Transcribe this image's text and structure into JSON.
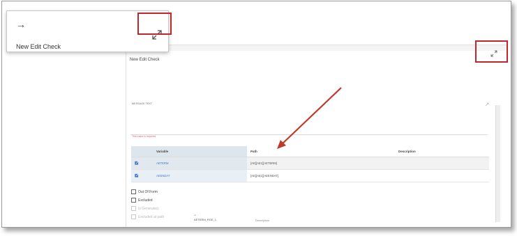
{
  "zoom_card": {
    "back_arrow": "→",
    "title": "New Edit Check"
  },
  "dialog": {
    "title": "New Edit Check",
    "message_label": "MESSAGE TEXT",
    "error_text": "This value is required"
  },
  "table": {
    "headers": [
      "",
      "Variable",
      "Path",
      "Description"
    ],
    "rows": [
      {
        "variable": "AETERM",
        "path": "[AE][AE1][AETERM]",
        "description": ""
      },
      {
        "variable": "AEENDAT",
        "path": "[AE][AE1][AEENDAT]",
        "description": ""
      }
    ]
  },
  "checkboxes": [
    {
      "label": "Out Of Form",
      "disabled": false
    },
    {
      "label": "Excluded",
      "disabled": false
    },
    {
      "label": "Is Generated",
      "disabled": true
    },
    {
      "label": "Excluded at path",
      "disabled": true
    }
  ],
  "footer": {
    "id_label": "Id",
    "id_value": "AETERM_RGE_1",
    "description_label": "Description"
  },
  "colors": {
    "highlight_red": "#c0262d",
    "link_blue": "#3e79c7",
    "error_red": "#e06060"
  },
  "icons": [
    "back-arrow-icon",
    "expand-icon",
    "edit-icon"
  ]
}
